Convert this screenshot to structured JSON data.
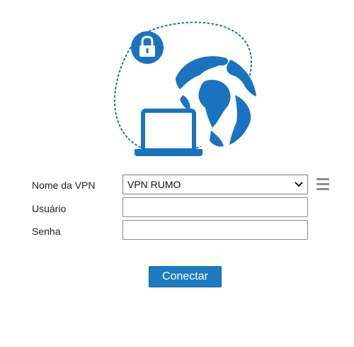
{
  "form": {
    "vpn_name_label": "Nome da VPN",
    "vpn_selected": "VPN RUMO",
    "user_label": "Usuário",
    "user_value": "",
    "password_label": "Senha",
    "password_value": ""
  },
  "actions": {
    "connect_label": "Conectar"
  },
  "icons": {
    "illustration": "vpn-globe-laptop-lock",
    "lock": "lock-icon",
    "menu": "hamburger-menu-icon",
    "dropdown": "chevron-down-icon"
  },
  "colors": {
    "accent": "#1b7cc2",
    "illustration_blue": "#1a73c0",
    "menu_gray": "#8c8c8c"
  }
}
